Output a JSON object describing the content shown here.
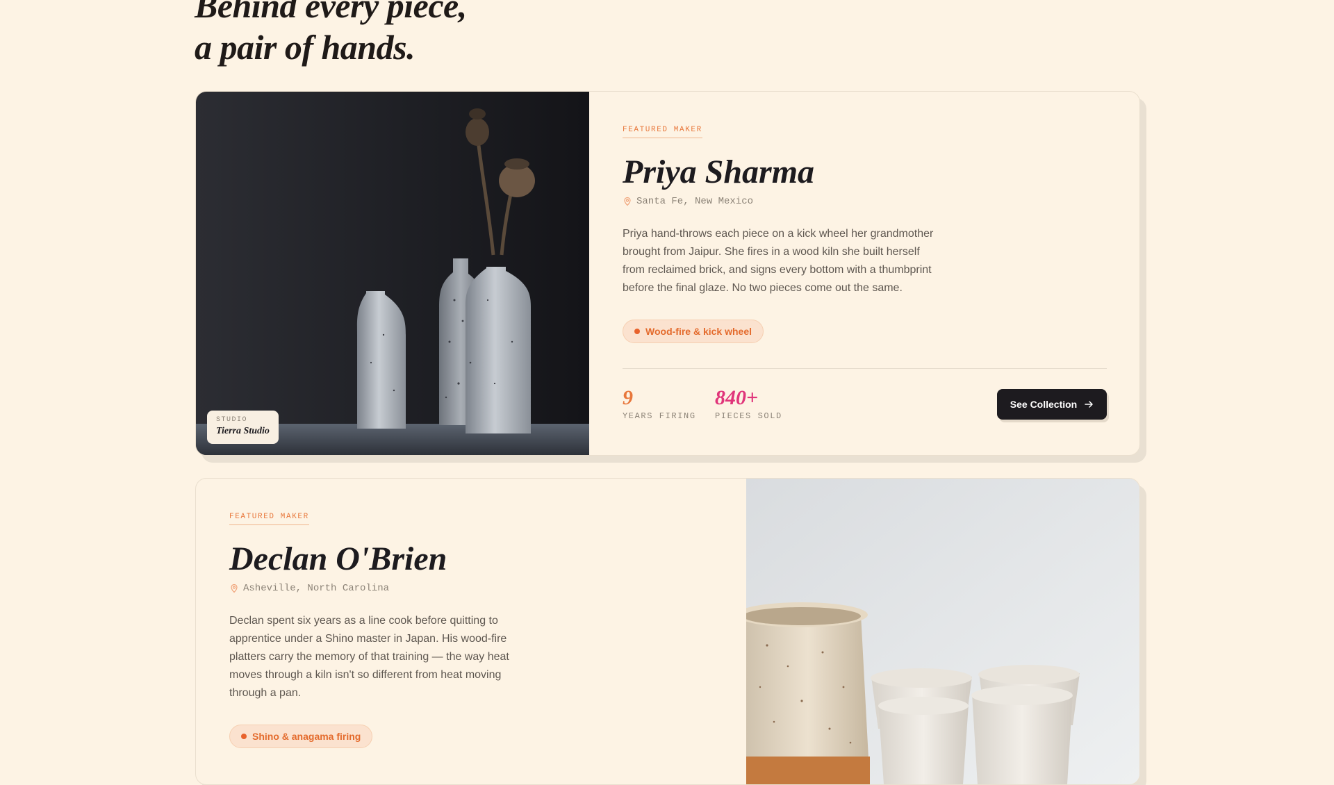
{
  "headline": {
    "line1": "Behind every piece,",
    "line2": "a pair of hands."
  },
  "makers": [
    {
      "eyebrow": "FEATURED MAKER",
      "name": "Priya Sharma",
      "location": "Santa Fe, New Mexico",
      "bio": "Priya hand-throws each piece on a kick wheel her grandmother brought from Jaipur. She fires in a wood kiln she built herself from reclaimed brick, and signs every bottom with a thumbprint before the final glaze. No two pieces come out the same.",
      "tag": "Wood-fire & kick wheel",
      "studio_label": "STUDIO",
      "studio_name": "Tierra Studio",
      "stats": [
        {
          "value": "9",
          "label": "YEARS FIRING"
        },
        {
          "value": "840+",
          "label": "PIECES SOLD"
        }
      ],
      "cta": "See Collection"
    },
    {
      "eyebrow": "FEATURED MAKER",
      "name": "Declan O'Brien",
      "location": "Asheville, North Carolina",
      "bio": "Declan spent six years as a line cook before quitting to apprentice under a Shino master in Japan. His wood-fire platters carry the memory of that training — the way heat moves through a kiln isn't so different from heat moving through a pan.",
      "tag": "Shino & anagama firing"
    }
  ],
  "icons": {
    "location": "map-pin-icon",
    "cta": "arrow-right-icon"
  },
  "colors": {
    "background": "#fdf3e4",
    "accent_orange": "#e8773b",
    "accent_pink": "#e0357a",
    "button_dark": "#1d1b1f"
  }
}
